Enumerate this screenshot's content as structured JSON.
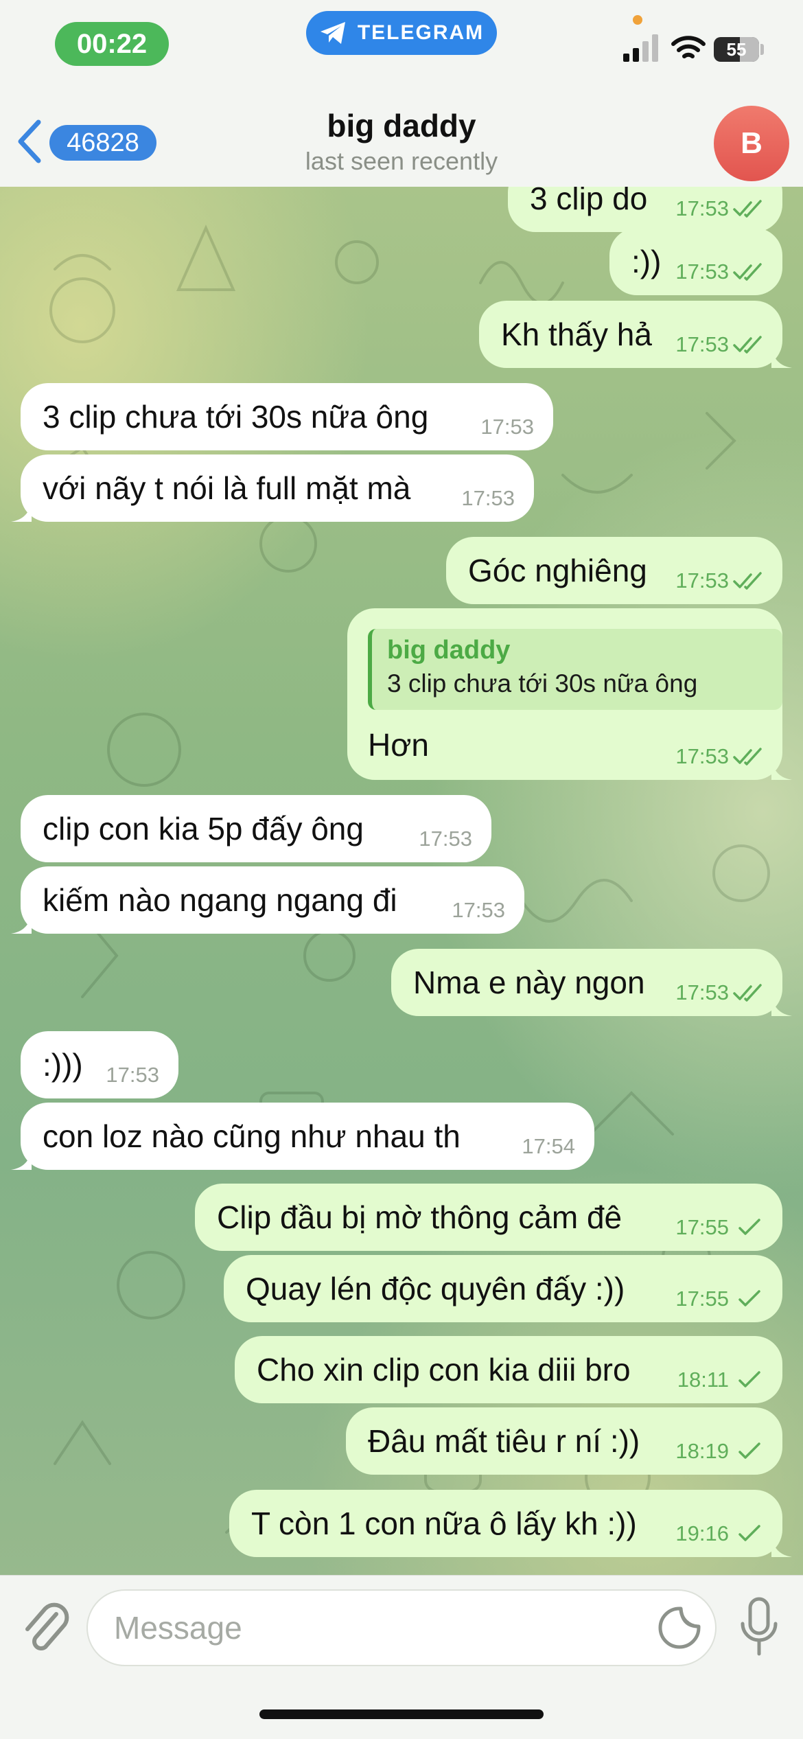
{
  "status_bar": {
    "time": "00:22",
    "app_name": "TELEGRAM",
    "battery": "55"
  },
  "header": {
    "back_count": "46828",
    "title": "big daddy",
    "subtitle": "last seen recently",
    "avatar_letter": "B"
  },
  "messages": [
    {
      "direction": "out",
      "text": "3 clip do",
      "time": "17:53",
      "status": "read"
    },
    {
      "direction": "out",
      "text": ":))",
      "time": "17:53",
      "status": "read"
    },
    {
      "direction": "out",
      "text": "Kh thấy hả",
      "time": "17:53",
      "status": "read"
    },
    {
      "direction": "in",
      "text": "3 clip chưa tới 30s nữa ông",
      "time": "17:53"
    },
    {
      "direction": "in",
      "text": "với nãy t nói là full mặt mà",
      "time": "17:53"
    },
    {
      "direction": "out",
      "text": "Góc nghiêng",
      "time": "17:53",
      "status": "read"
    },
    {
      "direction": "out",
      "text": "Hơn",
      "time": "17:53",
      "status": "read",
      "reply_to": {
        "name": "big daddy",
        "text": "3 clip chưa tới 30s nữa ông"
      }
    },
    {
      "direction": "in",
      "text": "clip con kia 5p đấy ông",
      "time": "17:53"
    },
    {
      "direction": "in",
      "text": "kiếm nào ngang ngang đi",
      "time": "17:53"
    },
    {
      "direction": "out",
      "text": "Nma e này ngon",
      "time": "17:53",
      "status": "read"
    },
    {
      "direction": "in",
      "text": ":)))",
      "time": "17:53"
    },
    {
      "direction": "in",
      "text": "con loz nào cũng như nhau th",
      "time": "17:54"
    },
    {
      "direction": "out",
      "text": "Clip đầu bị mờ thông cảm đê",
      "time": "17:55",
      "status": "sent"
    },
    {
      "direction": "out",
      "text": "Quay lén độc quyên đấy :))",
      "time": "17:55",
      "status": "sent"
    },
    {
      "direction": "out",
      "text": "Cho xin clip con kia diii bro",
      "time": "18:11",
      "status": "sent"
    },
    {
      "direction": "out",
      "text": "Đâu mất tiêu r ní :))",
      "time": "18:19",
      "status": "sent"
    },
    {
      "direction": "out",
      "text": "T còn 1 con nữa ô lấy kh :))",
      "time": "19:16",
      "status": "sent"
    }
  ],
  "input": {
    "placeholder": "Message"
  },
  "icons": {
    "back": "chevron-left-icon",
    "telegram": "telegram-plane-icon",
    "attach": "paperclip-icon",
    "sticker": "sticker-icon",
    "mic": "microphone-icon",
    "read": "double-check-icon",
    "sent": "single-check-icon"
  },
  "colors": {
    "accent": "#3b86e0",
    "outgoing_bubble": "#e3fbcf",
    "incoming_bubble": "#ffffff",
    "check": "#5fae5a",
    "avatar": "#e8605a"
  }
}
